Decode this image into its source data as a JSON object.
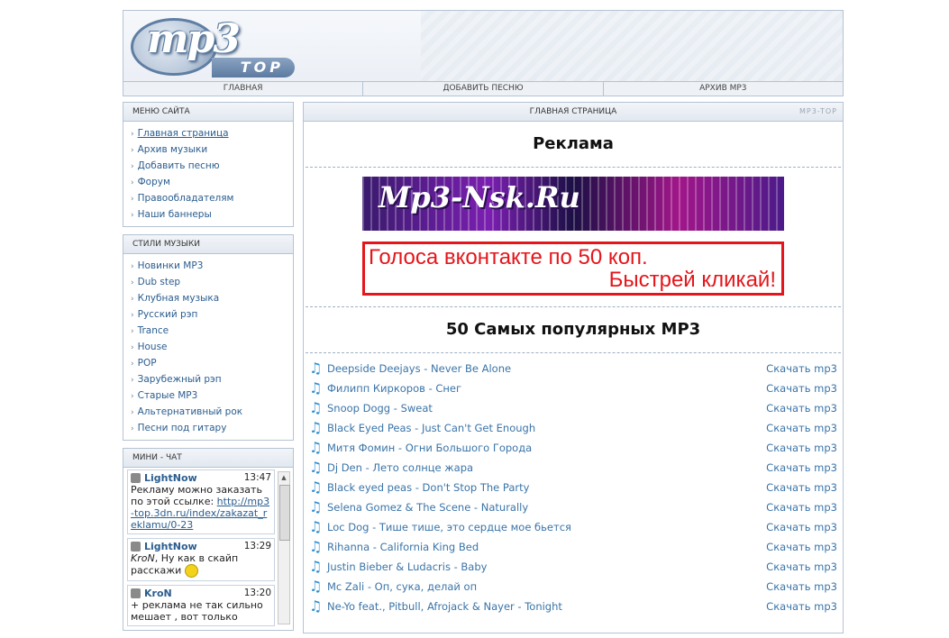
{
  "header": {
    "logo_main": "mp3",
    "logo_sub": "TOP",
    "nav": [
      "ГЛАВНАЯ",
      "ДОБАВИТЬ ПЕСНЮ",
      "АРХИВ MP3"
    ]
  },
  "menu": {
    "title": "МЕНЮ САЙТА",
    "items": [
      "Главная страница",
      "Архив музыки",
      "Добавить песню",
      "Форум",
      "Правообладателям",
      "Наши баннеры"
    ]
  },
  "styles": {
    "title": "СТИЛИ МУЗЫКИ",
    "items": [
      "Новинки MP3",
      "Dub step",
      "Клубная музыка",
      "Русский рэп",
      "Trance",
      "House",
      "POP",
      "Зарубежный рэп",
      "Старые MP3",
      "Альтернативный рок",
      "Песни под гитару"
    ]
  },
  "chat": {
    "title": "МИНИ - ЧАТ",
    "messages": [
      {
        "user": "LightNow",
        "time": "13:47",
        "text": "Рекламу можно заказать по этой ссылке: ",
        "link": "http://mp3-top.3dn.ru/index/zakazat_reklamu/0-23"
      },
      {
        "user": "LightNow",
        "time": "13:29",
        "addressee": "KroN",
        "text": ", Ну как в скайп расскажи"
      },
      {
        "user": "KroN",
        "time": "13:20",
        "text": "+ реклама не так сильно мешает , вот только"
      }
    ]
  },
  "main": {
    "header": "ГЛАВНАЯ СТРАНИЦА",
    "header_tag": "MP3-TOP",
    "ads_title": "Реклама",
    "banner1_text": "Mp3-Nsk.Ru",
    "banner2_line1": "Голоса вконтакте по 50 коп.",
    "banner2_line2": "Быстрей кликай!",
    "top_title": "50 Самых популярных MP3",
    "download_label": "Скачать mp3",
    "songs": [
      "Deepside Deejays - Never Be Alone",
      "Филипп Киркоров - Снег",
      "Snoop Dogg - Sweat",
      "Black Eyed Peas - Just Can't Get Enough",
      "Митя Фомин - Огни Большого Города",
      "Dj Den - Лето солнце жара",
      "Black eyed peas - Don't Stop The Party",
      "Selena Gomez & The Scene - Naturally",
      "Loc Dog - Тише тише, это сердце мое бьется",
      "Rihanna - California King Bed",
      "Justin Bieber & Ludacris - Baby",
      "Mc Zali - Оп, сука, делай оп",
      "Ne-Yo feat., Pitbull, Afrojack & Nayer - Tonight"
    ]
  }
}
